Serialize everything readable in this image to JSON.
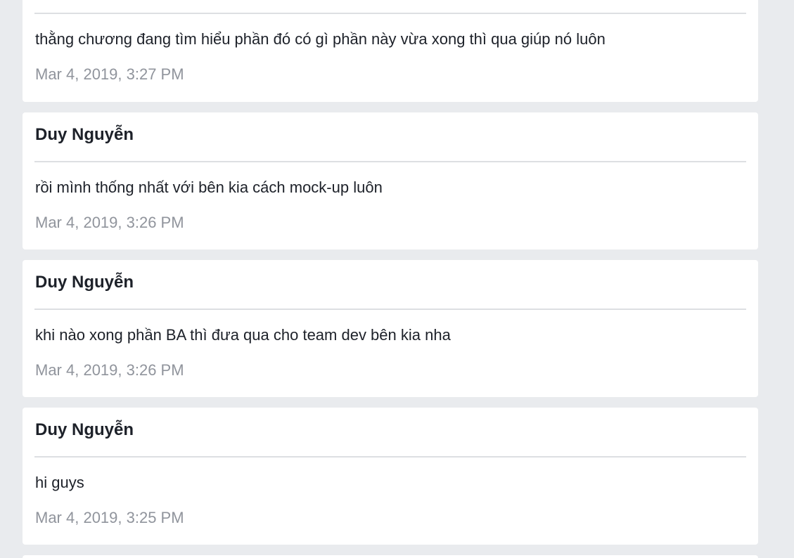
{
  "messages": [
    {
      "author": "",
      "text": "thằng chương đang tìm hiểu phần đó có gì phần này vừa xong thì qua giúp nó luôn",
      "timestamp": "Mar 4, 2019, 3:27 PM"
    },
    {
      "author": "Duy Nguyễn",
      "text": "rồi mình thống nhất với bên kia cách mock-up luôn",
      "timestamp": "Mar 4, 2019, 3:26 PM"
    },
    {
      "author": "Duy Nguyễn",
      "text": "khi nào xong phần BA thì đưa qua cho team dev bên kia nha",
      "timestamp": "Mar 4, 2019, 3:26 PM"
    },
    {
      "author": "Duy Nguyễn",
      "text": "hi guys",
      "timestamp": "Mar 4, 2019, 3:25 PM"
    }
  ]
}
